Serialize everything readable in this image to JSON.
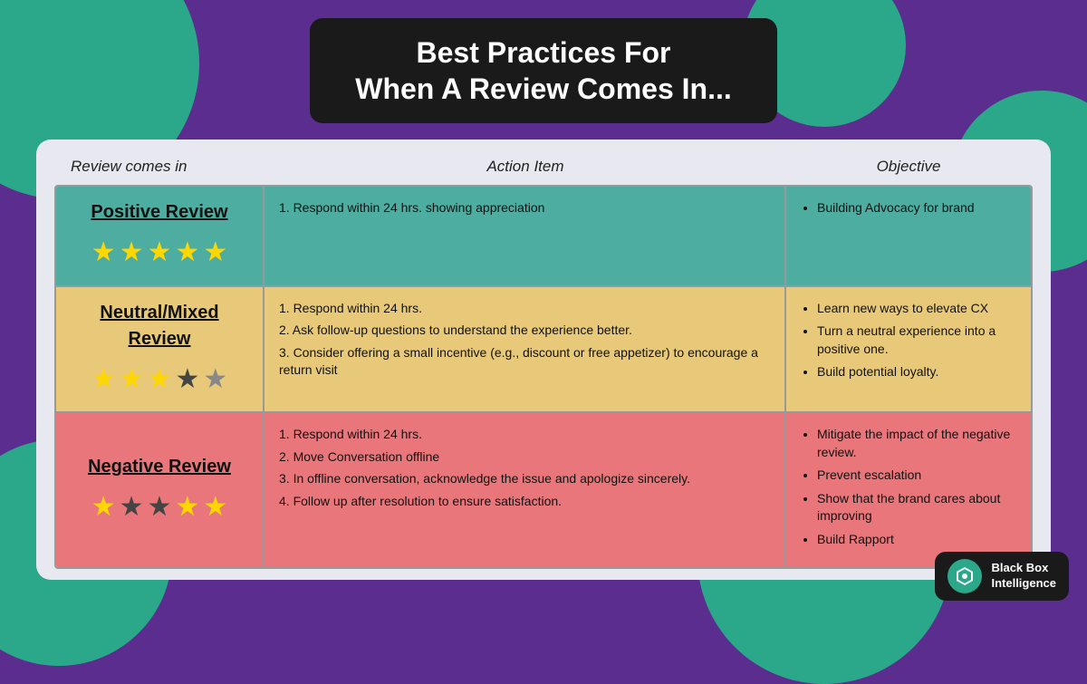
{
  "background": {
    "color": "#5B2D8E",
    "accent_color": "#2BA88A"
  },
  "title": {
    "line1": "Best Practices For",
    "line2": "When A Review Comes In..."
  },
  "column_headers": {
    "col1": "Review comes in",
    "col2": "Action  Item",
    "col3": "Objective"
  },
  "rows": [
    {
      "id": "positive",
      "review_label": "Positive Review",
      "stars": [
        1,
        1,
        1,
        1,
        1
      ],
      "action_items": [
        "1. Respond within 24 hrs. showing appreciation"
      ],
      "objectives": [
        "Building Advocacy for brand"
      ]
    },
    {
      "id": "neutral",
      "review_label": "Neutral/Mixed\nReview",
      "stars": [
        1,
        1,
        1,
        0,
        0.5
      ],
      "action_items": [
        "1. Respond within 24 hrs.",
        "2.  Ask follow-up questions to understand the experience better.",
        "3. Consider offering a small incentive (e.g., discount or free appetizer) to encourage a return visit"
      ],
      "objectives": [
        "Learn new ways to elevate CX",
        "Turn a neutral experience into a positive one.",
        "Build potential loyalty."
      ]
    },
    {
      "id": "negative",
      "review_label": "Negative Review",
      "stars": [
        1,
        0,
        0,
        1,
        1
      ],
      "action_items": [
        "1. Respond within 24 hrs.",
        "2. Move Conversation offline",
        "3. In offline conversation, acknowledge the issue and apologize sincerely.",
        "4.  Follow up after resolution to ensure satisfaction."
      ],
      "objectives": [
        "Mitigate the impact of the negative review.",
        "Prevent escalation",
        "Show that the brand cares about improving",
        "Build Rapport"
      ]
    }
  ],
  "logo": {
    "icon_text": "⬡",
    "name_line1": "Black Box",
    "name_line2": "Intelligence"
  }
}
